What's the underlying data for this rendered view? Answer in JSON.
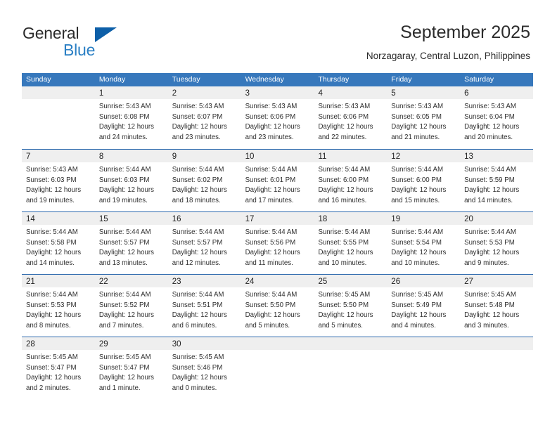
{
  "brand": {
    "name_part1": "General",
    "name_part2": "Blue",
    "triangle_color": "#0d5fa8",
    "blue_text_color": "#2a7fc4"
  },
  "header": {
    "title": "September 2025",
    "subtitle": "Norzagaray, Central Luzon, Philippines"
  },
  "theme": {
    "header_row_bg": "#3778bc",
    "row_separator": "#2a68ad",
    "day_number_band_bg": "#efefef",
    "text_color": "#2e2e2e"
  },
  "weekdays": [
    "Sunday",
    "Monday",
    "Tuesday",
    "Wednesday",
    "Thursday",
    "Friday",
    "Saturday"
  ],
  "weeks": [
    [
      {
        "day": "",
        "lines": []
      },
      {
        "day": "1",
        "lines": [
          "Sunrise: 5:43 AM",
          "Sunset: 6:08 PM",
          "Daylight: 12 hours",
          "and 24 minutes."
        ]
      },
      {
        "day": "2",
        "lines": [
          "Sunrise: 5:43 AM",
          "Sunset: 6:07 PM",
          "Daylight: 12 hours",
          "and 23 minutes."
        ]
      },
      {
        "day": "3",
        "lines": [
          "Sunrise: 5:43 AM",
          "Sunset: 6:06 PM",
          "Daylight: 12 hours",
          "and 23 minutes."
        ]
      },
      {
        "day": "4",
        "lines": [
          "Sunrise: 5:43 AM",
          "Sunset: 6:06 PM",
          "Daylight: 12 hours",
          "and 22 minutes."
        ]
      },
      {
        "day": "5",
        "lines": [
          "Sunrise: 5:43 AM",
          "Sunset: 6:05 PM",
          "Daylight: 12 hours",
          "and 21 minutes."
        ]
      },
      {
        "day": "6",
        "lines": [
          "Sunrise: 5:43 AM",
          "Sunset: 6:04 PM",
          "Daylight: 12 hours",
          "and 20 minutes."
        ]
      }
    ],
    [
      {
        "day": "7",
        "lines": [
          "Sunrise: 5:43 AM",
          "Sunset: 6:03 PM",
          "Daylight: 12 hours",
          "and 19 minutes."
        ]
      },
      {
        "day": "8",
        "lines": [
          "Sunrise: 5:44 AM",
          "Sunset: 6:03 PM",
          "Daylight: 12 hours",
          "and 19 minutes."
        ]
      },
      {
        "day": "9",
        "lines": [
          "Sunrise: 5:44 AM",
          "Sunset: 6:02 PM",
          "Daylight: 12 hours",
          "and 18 minutes."
        ]
      },
      {
        "day": "10",
        "lines": [
          "Sunrise: 5:44 AM",
          "Sunset: 6:01 PM",
          "Daylight: 12 hours",
          "and 17 minutes."
        ]
      },
      {
        "day": "11",
        "lines": [
          "Sunrise: 5:44 AM",
          "Sunset: 6:00 PM",
          "Daylight: 12 hours",
          "and 16 minutes."
        ]
      },
      {
        "day": "12",
        "lines": [
          "Sunrise: 5:44 AM",
          "Sunset: 6:00 PM",
          "Daylight: 12 hours",
          "and 15 minutes."
        ]
      },
      {
        "day": "13",
        "lines": [
          "Sunrise: 5:44 AM",
          "Sunset: 5:59 PM",
          "Daylight: 12 hours",
          "and 14 minutes."
        ]
      }
    ],
    [
      {
        "day": "14",
        "lines": [
          "Sunrise: 5:44 AM",
          "Sunset: 5:58 PM",
          "Daylight: 12 hours",
          "and 14 minutes."
        ]
      },
      {
        "day": "15",
        "lines": [
          "Sunrise: 5:44 AM",
          "Sunset: 5:57 PM",
          "Daylight: 12 hours",
          "and 13 minutes."
        ]
      },
      {
        "day": "16",
        "lines": [
          "Sunrise: 5:44 AM",
          "Sunset: 5:57 PM",
          "Daylight: 12 hours",
          "and 12 minutes."
        ]
      },
      {
        "day": "17",
        "lines": [
          "Sunrise: 5:44 AM",
          "Sunset: 5:56 PM",
          "Daylight: 12 hours",
          "and 11 minutes."
        ]
      },
      {
        "day": "18",
        "lines": [
          "Sunrise: 5:44 AM",
          "Sunset: 5:55 PM",
          "Daylight: 12 hours",
          "and 10 minutes."
        ]
      },
      {
        "day": "19",
        "lines": [
          "Sunrise: 5:44 AM",
          "Sunset: 5:54 PM",
          "Daylight: 12 hours",
          "and 10 minutes."
        ]
      },
      {
        "day": "20",
        "lines": [
          "Sunrise: 5:44 AM",
          "Sunset: 5:53 PM",
          "Daylight: 12 hours",
          "and 9 minutes."
        ]
      }
    ],
    [
      {
        "day": "21",
        "lines": [
          "Sunrise: 5:44 AM",
          "Sunset: 5:53 PM",
          "Daylight: 12 hours",
          "and 8 minutes."
        ]
      },
      {
        "day": "22",
        "lines": [
          "Sunrise: 5:44 AM",
          "Sunset: 5:52 PM",
          "Daylight: 12 hours",
          "and 7 minutes."
        ]
      },
      {
        "day": "23",
        "lines": [
          "Sunrise: 5:44 AM",
          "Sunset: 5:51 PM",
          "Daylight: 12 hours",
          "and 6 minutes."
        ]
      },
      {
        "day": "24",
        "lines": [
          "Sunrise: 5:44 AM",
          "Sunset: 5:50 PM",
          "Daylight: 12 hours",
          "and 5 minutes."
        ]
      },
      {
        "day": "25",
        "lines": [
          "Sunrise: 5:45 AM",
          "Sunset: 5:50 PM",
          "Daylight: 12 hours",
          "and 5 minutes."
        ]
      },
      {
        "day": "26",
        "lines": [
          "Sunrise: 5:45 AM",
          "Sunset: 5:49 PM",
          "Daylight: 12 hours",
          "and 4 minutes."
        ]
      },
      {
        "day": "27",
        "lines": [
          "Sunrise: 5:45 AM",
          "Sunset: 5:48 PM",
          "Daylight: 12 hours",
          "and 3 minutes."
        ]
      }
    ],
    [
      {
        "day": "28",
        "lines": [
          "Sunrise: 5:45 AM",
          "Sunset: 5:47 PM",
          "Daylight: 12 hours",
          "and 2 minutes."
        ]
      },
      {
        "day": "29",
        "lines": [
          "Sunrise: 5:45 AM",
          "Sunset: 5:47 PM",
          "Daylight: 12 hours",
          "and 1 minute."
        ]
      },
      {
        "day": "30",
        "lines": [
          "Sunrise: 5:45 AM",
          "Sunset: 5:46 PM",
          "Daylight: 12 hours",
          "and 0 minutes."
        ]
      },
      {
        "day": "",
        "lines": []
      },
      {
        "day": "",
        "lines": []
      },
      {
        "day": "",
        "lines": []
      },
      {
        "day": "",
        "lines": []
      }
    ]
  ]
}
